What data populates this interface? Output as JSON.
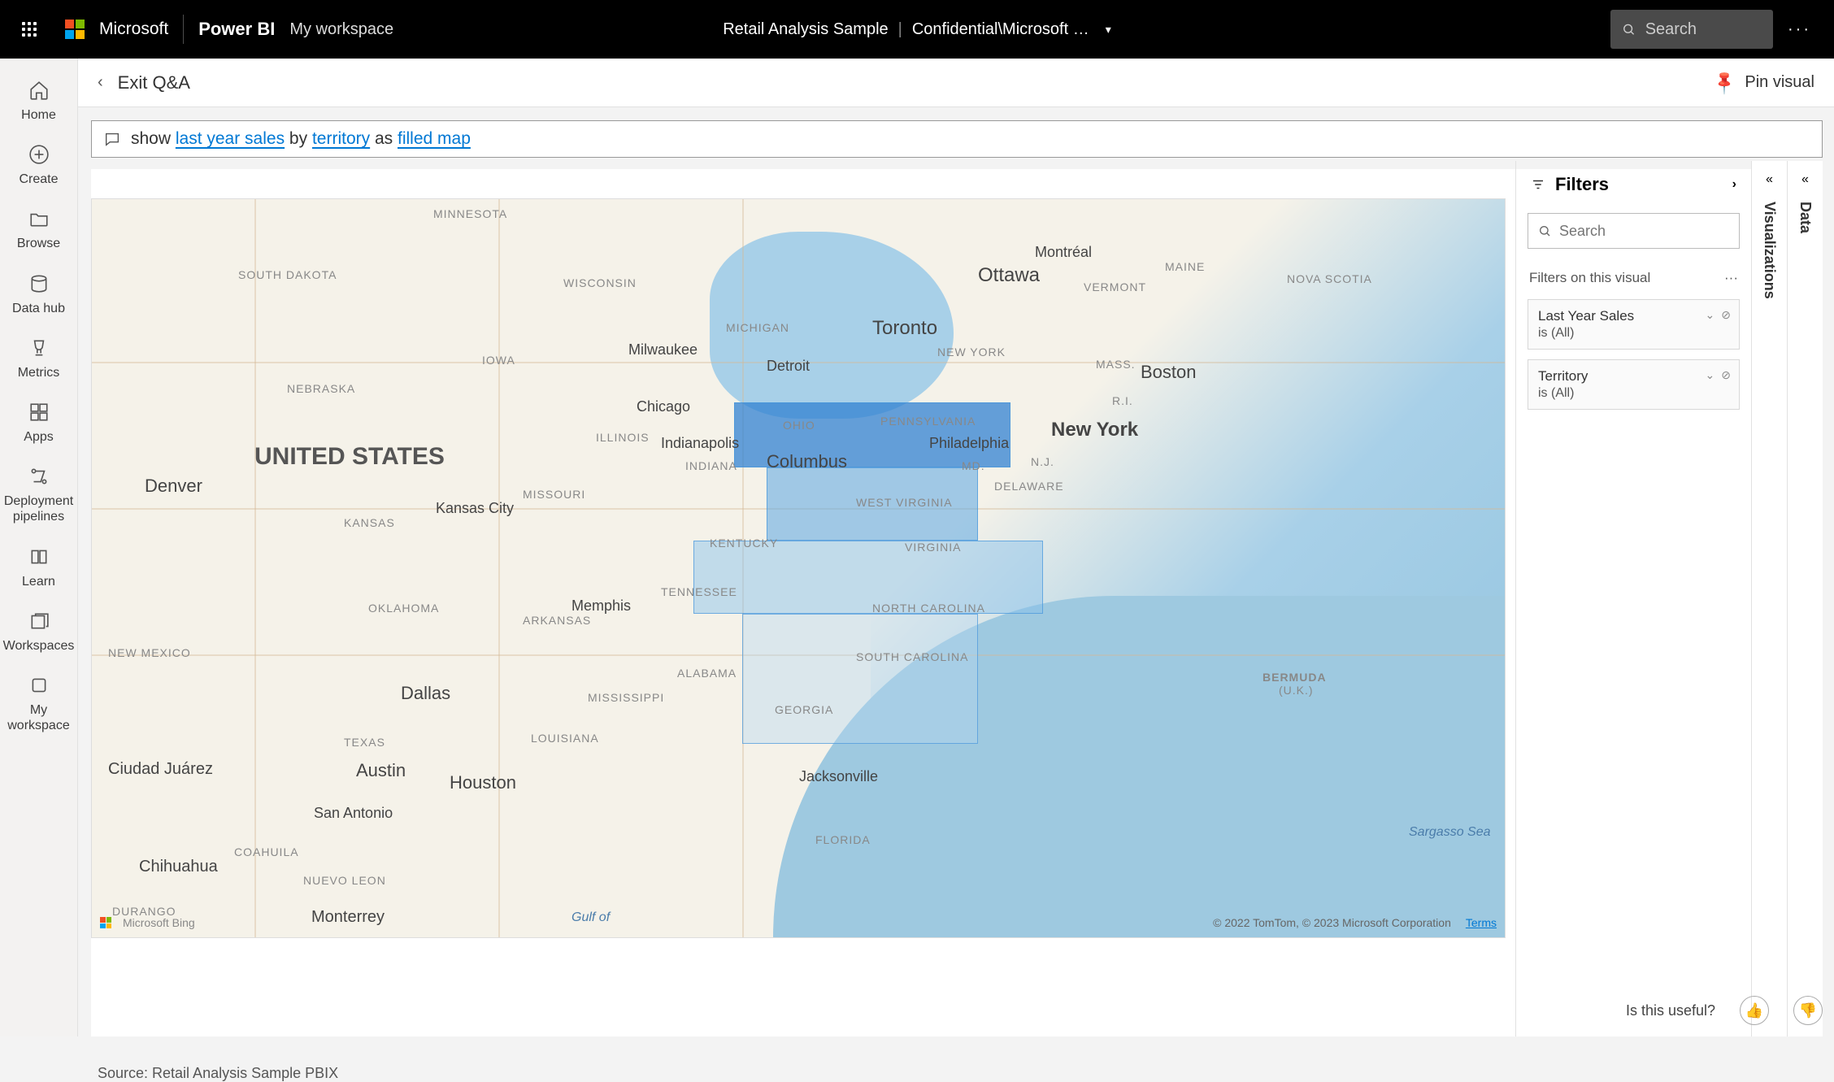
{
  "header": {
    "microsoft": "Microsoft",
    "product": "Power BI",
    "workspace": "My workspace",
    "report_name": "Retail Analysis Sample",
    "sensitivity": "Confidential\\Microsoft …",
    "search_placeholder": "Search"
  },
  "nav": [
    {
      "label": "Home"
    },
    {
      "label": "Create"
    },
    {
      "label": "Browse"
    },
    {
      "label": "Data hub"
    },
    {
      "label": "Metrics"
    },
    {
      "label": "Apps"
    },
    {
      "label": "Deployment pipelines"
    },
    {
      "label": "Learn"
    },
    {
      "label": "Workspaces"
    },
    {
      "label": "My workspace"
    }
  ],
  "subheader": {
    "exit": "Exit Q&A",
    "pin": "Pin visual"
  },
  "qa": {
    "prefix": "show ",
    "phrase1": "last year sales",
    "mid1": " by ",
    "phrase2": "territory",
    "mid2": " as ",
    "phrase3": "filled map"
  },
  "map": {
    "country": "UNITED STATES",
    "labels": {
      "minnesota": "MINNESOTA",
      "south_dakota": "SOUTH DAKOTA",
      "wisconsin": "WISCONSIN",
      "michigan": "MICHIGAN",
      "iowa": "IOWA",
      "nebraska": "NEBRASKA",
      "illinois": "ILLINOIS",
      "indiana": "INDIANA",
      "kansas": "KANSAS",
      "missouri": "MISSOURI",
      "oklahoma": "OKLAHOMA",
      "arkansas": "ARKANSAS",
      "texas": "TEXAS",
      "louisiana": "LOUISIANA",
      "mississippi": "MISSISSIPPI",
      "alabama": "ALABAMA",
      "tennessee": "TENNESSEE",
      "kentucky": "KENTUCKY",
      "ohio": "OHIO",
      "pennsylvania": "PENNSYLVANIA",
      "new_york_state": "NEW YORK",
      "vermont": "VERMONT",
      "maine": "MAINE",
      "mass": "MASS.",
      "ri": "R.I.",
      "nj": "N.J.",
      "md": "MD.",
      "delaware": "DELAWARE",
      "west_virginia": "WEST VIRGINIA",
      "virginia": "VIRGINIA",
      "north_carolina": "NORTH CAROLINA",
      "south_carolina": "SOUTH CAROLINA",
      "georgia": "GEORGIA",
      "florida": "FLORIDA",
      "new_mexico": "NEW MEXICO",
      "nova_scotia": "NOVA SCOTIA",
      "coahuila": "COAHUILA",
      "nuevo_leon": "NUEVO LEON",
      "durango": "DURANGO"
    },
    "cities": {
      "milwaukee": "Milwaukee",
      "chicago": "Chicago",
      "indianapolis": "Indianapolis",
      "columbus": "Columbus",
      "detroit": "Detroit",
      "toronto": "Toronto",
      "ottawa": "Ottawa",
      "montreal": "Montréal",
      "boston": "Boston",
      "new_york": "New York",
      "philadelphia": "Philadelphia",
      "kansas_city": "Kansas City",
      "denver": "Denver",
      "dallas": "Dallas",
      "austin": "Austin",
      "houston": "Houston",
      "san_antonio": "San Antonio",
      "memphis": "Memphis",
      "jacksonville": "Jacksonville",
      "ciudad_juarez": "Ciudad Juárez",
      "chihuahua": "Chihuahua",
      "monterrey": "Monterrey"
    },
    "water": {
      "gulf": "Gulf of",
      "sargasso": "Sargasso Sea",
      "bermuda": "BERMUDA",
      "bermuda_uk": "(U.K.)"
    },
    "attribution": "© 2022 TomTom, © 2023 Microsoft Corporation",
    "terms": "Terms",
    "bing": "Microsoft Bing"
  },
  "source": "Source: Retail Analysis Sample PBIX",
  "filters": {
    "title": "Filters",
    "search_placeholder": "Search",
    "section": "Filters on this visual",
    "cards": [
      {
        "name": "Last Year Sales",
        "value": "is (All)"
      },
      {
        "name": "Territory",
        "value": "is (All)"
      }
    ]
  },
  "collapsed_panes": {
    "visualizations": "Visualizations",
    "data": "Data"
  },
  "feedback": {
    "question": "Is this useful?"
  }
}
